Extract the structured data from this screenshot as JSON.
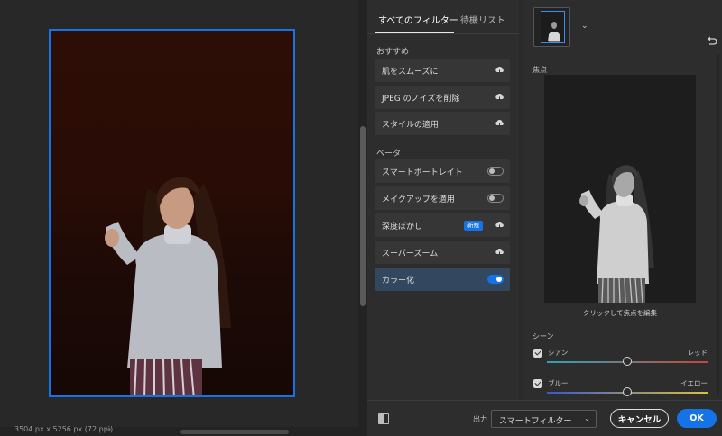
{
  "canvas": {
    "status_text": "3504 px x 5256 px (72 ppi)",
    "status_arrow": "›"
  },
  "filters_panel": {
    "tabs": [
      {
        "label": "すべてのフィルター",
        "active": true
      },
      {
        "label": "待機リスト",
        "active": false
      }
    ],
    "sections": [
      {
        "title": "おすすめ",
        "items": [
          {
            "label": "肌をスムーズに",
            "control": "cloud-download-icon"
          },
          {
            "label": "JPEG のノイズを削除",
            "control": "cloud-download-icon"
          },
          {
            "label": "スタイルの適用",
            "control": "cloud-download-icon"
          }
        ]
      },
      {
        "title": "ベータ",
        "items": [
          {
            "label": "スマートポートレイト",
            "control": "toggle",
            "on": false
          },
          {
            "label": "メイクアップを適用",
            "control": "toggle",
            "on": false
          },
          {
            "label": "深度ぼかし",
            "control": "cloud-download-icon",
            "badge": "新規"
          },
          {
            "label": "スーパーズーム",
            "control": "cloud-download-icon"
          },
          {
            "label": "カラー化",
            "control": "toggle",
            "on": true,
            "selected": true
          }
        ]
      }
    ]
  },
  "right_panel": {
    "thumb_chevron": "⌄",
    "focus_label": "焦点",
    "focus_hint": "クリックして焦点を編集",
    "scene_label": "シーン",
    "sliders": [
      {
        "left": "シアン",
        "right": "レッド",
        "checked": true,
        "value_fraction": 0.5,
        "gradient": [
          "#2aa6b8",
          "#c8453a"
        ]
      },
      {
        "left": "ブルー",
        "right": "イエロー",
        "checked": true,
        "value_fraction": 0.5,
        "gradient": [
          "#3a55d8",
          "#d8c23a"
        ]
      }
    ]
  },
  "bottom_bar": {
    "output_label": "出力",
    "output_value": "スマートフィルター",
    "output_chevron": "⌄",
    "cancel_label": "キャンセル",
    "ok_label": "OK"
  },
  "colors": {
    "accent": "#1473e6",
    "panel": "#2d2d2d",
    "canvas": "#282828",
    "selected_row": "#33475e"
  }
}
